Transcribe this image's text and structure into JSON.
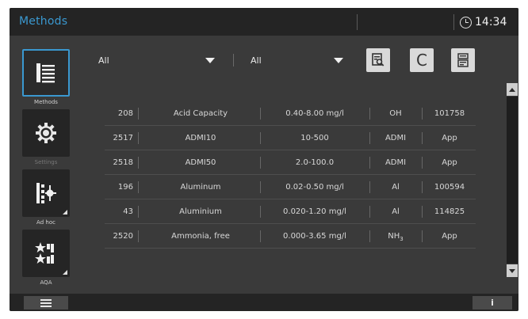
{
  "header": {
    "title": "Methods",
    "time": "14:34"
  },
  "sidebar": {
    "items": [
      {
        "label": "Methods",
        "icon": "methods-list-icon",
        "active": true
      },
      {
        "label": "Settings",
        "icon": "gear-icon",
        "active": false
      },
      {
        "label": "Ad hoc",
        "icon": "ad-hoc-icon",
        "active": false
      },
      {
        "label": "AQA",
        "icon": "aqa-stars-icon",
        "active": false
      }
    ]
  },
  "filters": {
    "left": "All",
    "right": "All"
  },
  "toolbar": {
    "search_icon": "search-document-icon",
    "clear_label": "C",
    "info_icon": "method-info-icon"
  },
  "table": {
    "rows": [
      {
        "id": "208",
        "name": "Acid Capacity",
        "range": "0.40-8.00 mg/l",
        "param": "OH",
        "param_sub": "",
        "ref": "101758"
      },
      {
        "id": "2517",
        "name": "ADMI10",
        "range": "10-500",
        "param": "ADMI",
        "param_sub": "",
        "ref": "App"
      },
      {
        "id": "2518",
        "name": "ADMI50",
        "range": "2.0-100.0",
        "param": "ADMI",
        "param_sub": "",
        "ref": "App"
      },
      {
        "id": "196",
        "name": "Aluminum",
        "range": "0.02-0.50 mg/l",
        "param": "Al",
        "param_sub": "",
        "ref": "100594"
      },
      {
        "id": "43",
        "name": "Aluminium",
        "range": "0.020-1.20 mg/l",
        "param": "Al",
        "param_sub": "",
        "ref": "114825"
      },
      {
        "id": "2520",
        "name": "Ammonia, free",
        "range": "0.000-3.65 mg/l",
        "param": "NH",
        "param_sub": "3",
        "ref": "App"
      }
    ]
  },
  "footer": {
    "info_label": "i"
  },
  "colors": {
    "accent": "#3a98d0",
    "background": "#3a3a3a",
    "bar": "#242424"
  }
}
